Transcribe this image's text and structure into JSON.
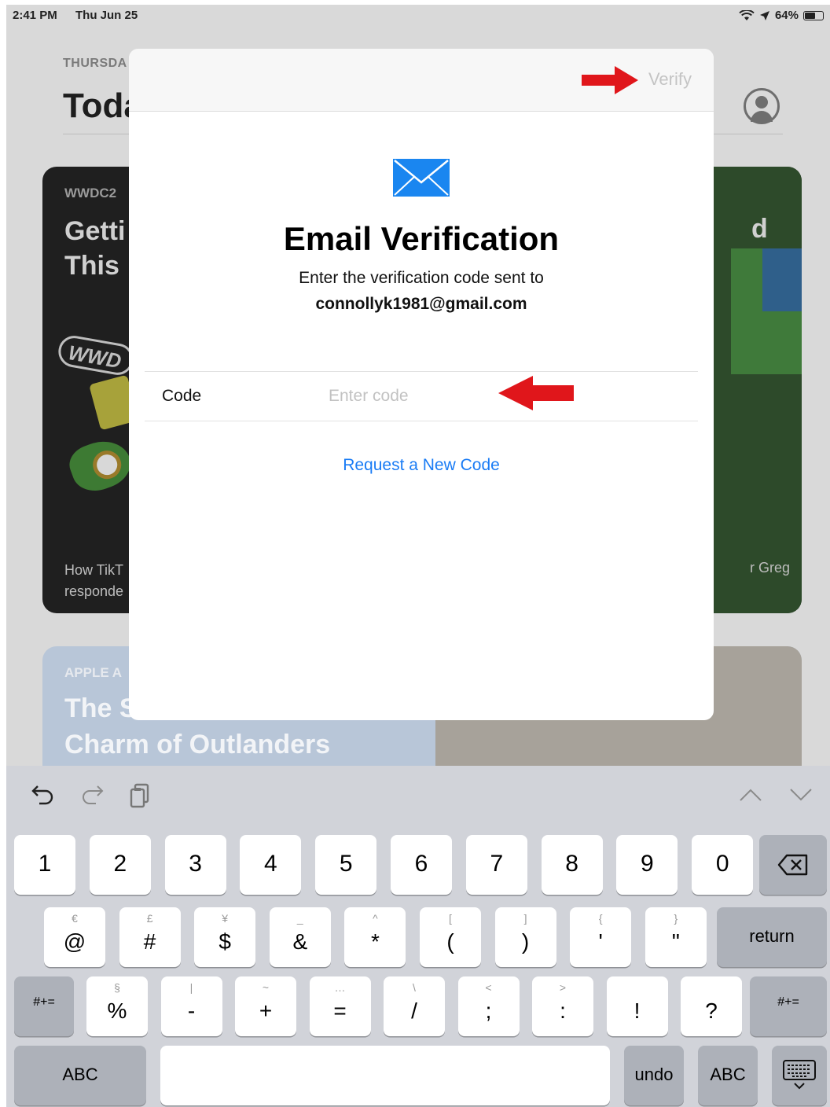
{
  "status_bar": {
    "time": "2:41 PM",
    "date": "Thu Jun 25",
    "battery": "64%",
    "battery_level": 0.64
  },
  "background_app": {
    "date": "THURSDA",
    "title": "Toda",
    "card1": {
      "eyebrow": "WWDC2",
      "headline_1": "Getti",
      "headline_2": "This",
      "headline_right": "d",
      "badge": "WWD",
      "footer_1": "How TikT",
      "footer_2": "responde",
      "footer_right": "r Greg"
    },
    "card2": {
      "eyebrow": "APPLE A",
      "headline_1": "The S",
      "headline_2": "Charm of Outlanders"
    }
  },
  "modal": {
    "verify_label": "Verify",
    "title": "Email Verification",
    "subtitle": "Enter the verification code sent to",
    "email": "connollyk1981@gmail.com",
    "code_label": "Code",
    "code_placeholder": "Enter code",
    "code_value": "",
    "request_link": "Request a New Code"
  },
  "colors": {
    "link": "#1a7cf5",
    "annotation_arrow": "#e0161b",
    "mail_icon": "#1a86f0"
  },
  "keyboard": {
    "toolbar": [
      "undo-icon",
      "redo-icon",
      "paste-icon",
      "chevron-up-icon",
      "chevron-down-icon"
    ],
    "row1": [
      "1",
      "2",
      "3",
      "4",
      "5",
      "6",
      "7",
      "8",
      "9",
      "0"
    ],
    "row2": [
      {
        "alt": "€",
        "main": "@"
      },
      {
        "alt": "£",
        "main": "#"
      },
      {
        "alt": "¥",
        "main": "$"
      },
      {
        "alt": "_",
        "main": "&"
      },
      {
        "alt": "^",
        "main": "*"
      },
      {
        "alt": "[",
        "main": "("
      },
      {
        "alt": "]",
        "main": ")"
      },
      {
        "alt": "{",
        "main": "'"
      },
      {
        "alt": "}",
        "main": "\""
      }
    ],
    "row3": [
      {
        "alt": "§",
        "main": "%"
      },
      {
        "alt": "|",
        "main": "-"
      },
      {
        "alt": "~",
        "main": "+"
      },
      {
        "alt": "…",
        "main": "="
      },
      {
        "alt": "\\",
        "main": "/"
      },
      {
        "alt": "<",
        "main": ";"
      },
      {
        "alt": ">",
        "main": ":"
      },
      {
        "alt": "",
        "main": "!"
      },
      {
        "alt": "",
        "main": "?"
      }
    ],
    "return_label": "return",
    "shift_label": "#+=",
    "abc_label": "ABC",
    "undo_label": "undo"
  }
}
